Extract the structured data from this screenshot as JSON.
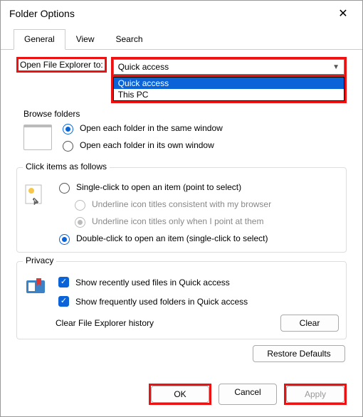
{
  "title": "Folder Options",
  "tabs": {
    "general": "General",
    "view": "View",
    "search": "Search"
  },
  "open_label": "Open File Explorer to:",
  "combo": {
    "selected": "Quick access",
    "opt1": "Quick access",
    "opt2": "This PC"
  },
  "browse": {
    "legend": "Browse folders",
    "same": "Open each folder in the same window",
    "own": "Open each folder in its own window"
  },
  "click": {
    "legend": "Click items as follows",
    "single": "Single-click to open an item (point to select)",
    "under_browser": "Underline icon titles consistent with my browser",
    "under_point": "Underline icon titles only when I point at them",
    "double": "Double-click to open an item (single-click to select)"
  },
  "privacy": {
    "legend": "Privacy",
    "recent": "Show recently used files in Quick access",
    "freq": "Show frequently used folders in Quick access",
    "clear_label": "Clear File Explorer history",
    "clear_btn": "Clear"
  },
  "restore": "Restore Defaults",
  "footer": {
    "ok": "OK",
    "cancel": "Cancel",
    "apply": "Apply"
  }
}
